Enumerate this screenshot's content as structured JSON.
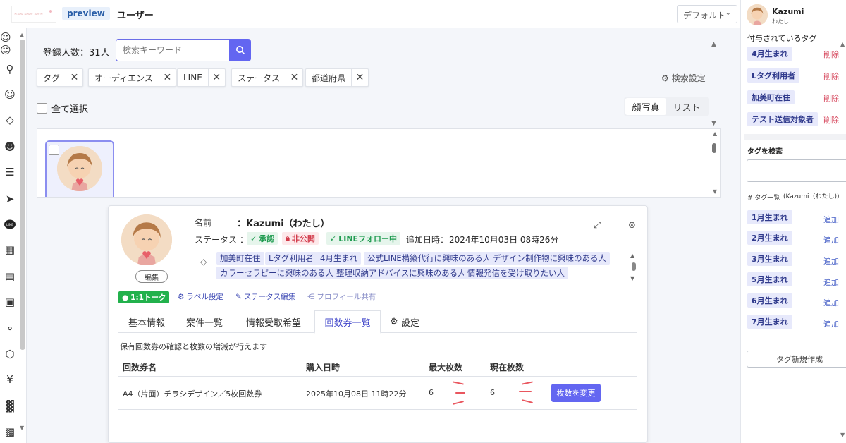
{
  "app": {
    "logo_text": "ロゴ",
    "badge": "preview",
    "page_title": "ユーザー",
    "view_select": "デフォルト"
  },
  "main": {
    "count_label": "登録人数：31人",
    "search_placeholder": "検索キーワード",
    "filters": [
      "タグ",
      "オーディエンス",
      "LINE",
      "ステータス",
      "都道府県"
    ],
    "search_settings": "検索設定",
    "select_all": "全て選択",
    "view_options": [
      "顔写真",
      "リスト"
    ],
    "active_view": "顔写真"
  },
  "detail": {
    "name_label": "名前",
    "name_value": "：Kazumi（わたし）",
    "status_label": "ステータス",
    "status_colon": "：",
    "badges": {
      "approved": "承認",
      "private": "非公開",
      "line_follow": "LINEフォロー中"
    },
    "added_label": "追加日時：",
    "added_value": "2024年10月03日 08時26分",
    "edit": "編集",
    "tags": [
      "加美町在住",
      "Lタグ利用者",
      "4月生まれ",
      "公式LINE構築代行に興味のある人",
      "デザイン制作物に興味のある人",
      "カラーセラピーに興味のある人",
      "整理収納アドバイスに興味のある人",
      "情報発信を受け取りたい人"
    ],
    "actions": {
      "talk": "1:1トーク",
      "label_settings": "ラベル設定",
      "status_edit": "ステータス編集",
      "profile_share": "プロフィール共有"
    },
    "tabs": [
      "基本情報",
      "案件一覧",
      "情報受取希望",
      "回数券一覧",
      "設定"
    ],
    "active_tab": "回数券一覧",
    "tab_description": "保有回数券の確認と枚数の増減が行えます",
    "table": {
      "headers": [
        "回数券名",
        "購入日時",
        "最大枚数",
        "現在枚数"
      ],
      "rows": [
        {
          "name": "A4（片面）チラシデザイン／5枚回数券",
          "purchased": "2025年10月08日 11時22分",
          "max": "6",
          "current": "6",
          "button": "枚数を変更"
        }
      ]
    }
  },
  "right_panel": {
    "user_name": "Kazumi",
    "user_sub": "わたし",
    "assigned_title": "付与されているタグ",
    "assigned_tags": [
      "4月生まれ",
      "Lタグ利用者",
      "加美町在住",
      "テスト送信対象者"
    ],
    "delete_label": "削除",
    "search_title": "タグを検索",
    "list_title": "# タグ一覧",
    "list_user": "(Kazumi（わたし))",
    "tag_list": [
      "1月生まれ",
      "2月生まれ",
      "3月生まれ",
      "5月生まれ",
      "6月生まれ",
      "7月生まれ"
    ],
    "add_label": "追加",
    "new_tag": "タグ新規作成"
  },
  "colors": {
    "accent": "#6366f1",
    "tag_bg": "#e7e9fb",
    "delete": "#d6455b",
    "line_green": "#22b14c"
  }
}
